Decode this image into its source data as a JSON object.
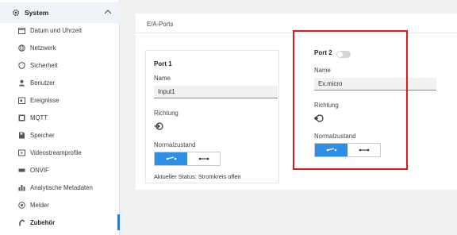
{
  "sidebar": {
    "section_title": "System",
    "items": [
      {
        "label": "Datum und Uhrzeit",
        "icon": "calendar-icon"
      },
      {
        "label": "Netzwerk",
        "icon": "network-icon"
      },
      {
        "label": "Sicherheit",
        "icon": "shield-icon"
      },
      {
        "label": "Benutzer",
        "icon": "user-icon"
      },
      {
        "label": "Ereignisse",
        "icon": "event-icon"
      },
      {
        "label": "MQTT",
        "icon": "mqtt-icon"
      },
      {
        "label": "Speicher",
        "icon": "storage-icon"
      },
      {
        "label": "Videostreamprofile",
        "icon": "video-profile-icon"
      },
      {
        "label": "ONVIF",
        "icon": "onvif-icon"
      },
      {
        "label": "Analytische Metadaten",
        "icon": "analytics-icon"
      },
      {
        "label": "Melder",
        "icon": "detector-icon"
      },
      {
        "label": "Zubehör",
        "icon": "accessory-icon",
        "active": true
      }
    ]
  },
  "main": {
    "title": "E/A-Ports",
    "port1": {
      "title": "Port 1",
      "name_label": "Name",
      "name_value": "Input1",
      "direction_label": "Richtung",
      "normal_state_label": "Normalzustand",
      "status_text": "Aktueller Status: Stromkreis offen"
    },
    "port2": {
      "title": "Port 2",
      "name_label": "Name",
      "name_value": "Ex.micro",
      "direction_label": "Richtung",
      "normal_state_label": "Normalzustand"
    }
  },
  "colors": {
    "accent": "#2d8ee6",
    "highlight": "#e4161c",
    "active_nav": "#2d7ad6"
  }
}
